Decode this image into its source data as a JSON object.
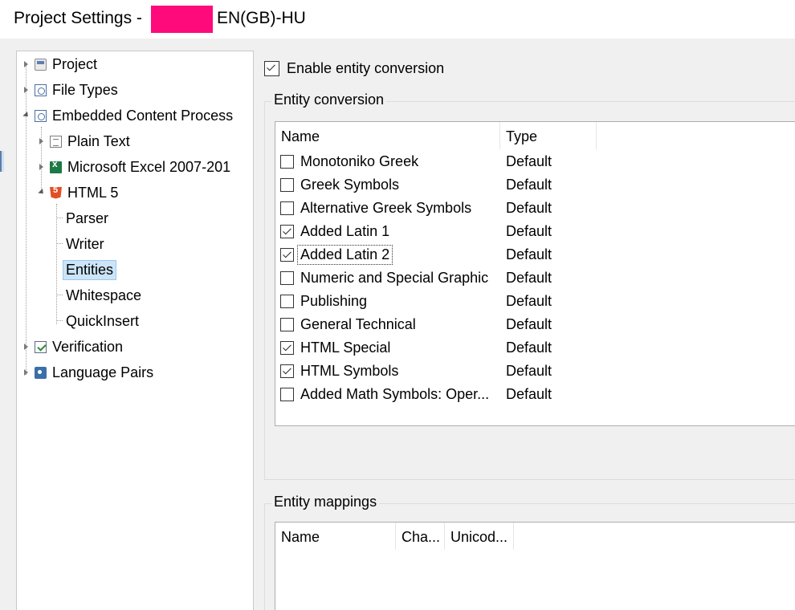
{
  "window": {
    "title": "Project Settings -",
    "title_suffix": "EN(GB)-HU"
  },
  "tree": {
    "items": [
      {
        "label": "Project",
        "icon": "project-icon"
      },
      {
        "label": "File Types",
        "icon": "file-types-icon"
      },
      {
        "label": "Embedded Content Process",
        "icon": "embedded-content-icon"
      },
      {
        "label": "Plain Text",
        "icon": "plain-text-icon"
      },
      {
        "label": "Microsoft Excel 2007-201",
        "icon": "excel-icon"
      },
      {
        "label": "HTML 5",
        "icon": "html5-icon"
      },
      {
        "label": "Parser"
      },
      {
        "label": "Writer"
      },
      {
        "label": "Entities",
        "selected": true
      },
      {
        "label": "Whitespace"
      },
      {
        "label": "QuickInsert"
      },
      {
        "label": "Verification",
        "icon": "verification-icon"
      },
      {
        "label": "Language Pairs",
        "icon": "language-pairs-icon"
      }
    ]
  },
  "settings": {
    "enable_label": "Enable entity conversion",
    "enable_checked": true,
    "conversion_group_title": "Entity conversion",
    "conversion_columns": [
      "Name",
      "Type"
    ],
    "conversion_rows": [
      {
        "name": "Monotoniko Greek",
        "type": "Default",
        "checked": false
      },
      {
        "name": "Greek Symbols",
        "type": "Default",
        "checked": false
      },
      {
        "name": "Alternative Greek Symbols",
        "type": "Default",
        "checked": false
      },
      {
        "name": "Added Latin 1",
        "type": "Default",
        "checked": true
      },
      {
        "name": "Added Latin 2",
        "type": "Default",
        "checked": true,
        "focused": true
      },
      {
        "name": "Numeric and Special Graphic",
        "type": "Default",
        "checked": false
      },
      {
        "name": "Publishing",
        "type": "Default",
        "checked": false
      },
      {
        "name": "General Technical",
        "type": "Default",
        "checked": false
      },
      {
        "name": "HTML Special",
        "type": "Default",
        "checked": true
      },
      {
        "name": "HTML Symbols",
        "type": "Default",
        "checked": true
      },
      {
        "name": "Added Math Symbols: Oper...",
        "type": "Default",
        "checked": false
      }
    ],
    "mapping_group_title": "Entity mappings",
    "mapping_columns": [
      "Name",
      "Cha...",
      "Unicod..."
    ]
  },
  "colors": {
    "redaction": "#ff0a7a",
    "selection_bg": "#cce4f7",
    "selection_border": "#99c9ef"
  }
}
